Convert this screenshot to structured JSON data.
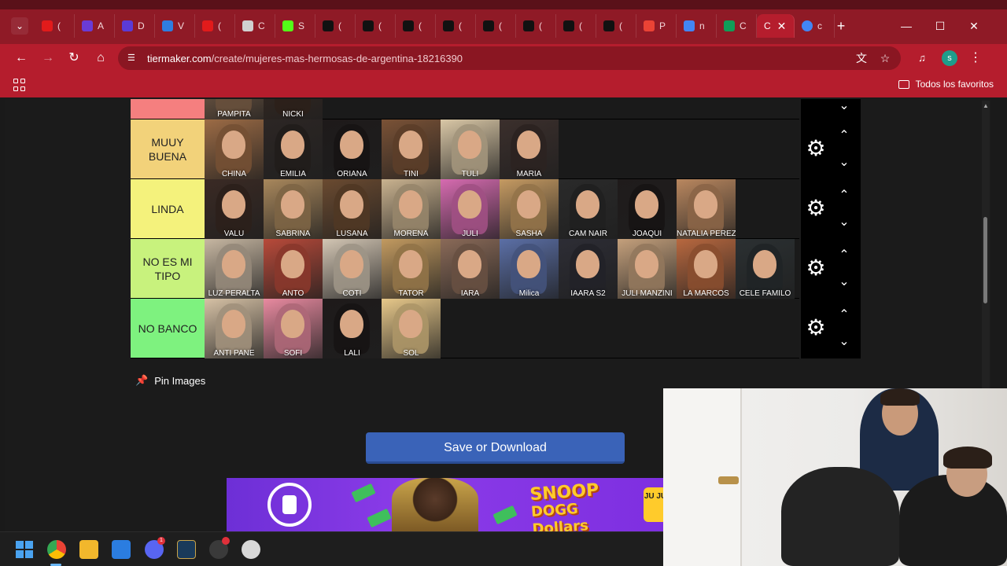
{
  "browser": {
    "tabs": [
      {
        "icon": "youtube-icon",
        "label": "(",
        "color": "#e21b1b"
      },
      {
        "icon": "moon-icon",
        "label": "A",
        "color": "#6a3bd6"
      },
      {
        "icon": "moon-icon",
        "label": "D",
        "color": "#5b3bd6"
      },
      {
        "icon": "check-icon",
        "label": "V",
        "color": "#2e7de0"
      },
      {
        "icon": "youtube-icon",
        "label": "(",
        "color": "#e21b1b"
      },
      {
        "icon": "openai-icon",
        "label": "C",
        "color": "#d0d0d0"
      },
      {
        "icon": "kick-icon",
        "label": "S",
        "color": "#53fc18"
      },
      {
        "icon": "tiktok-icon",
        "label": "(",
        "color": "#111111"
      },
      {
        "icon": "tiktok-icon",
        "label": "(",
        "color": "#111111"
      },
      {
        "icon": "tiktok-icon",
        "label": "(",
        "color": "#111111"
      },
      {
        "icon": "tiktok-icon",
        "label": "(",
        "color": "#111111"
      },
      {
        "icon": "tiktok-icon",
        "label": "(",
        "color": "#111111"
      },
      {
        "icon": "tiktok-icon",
        "label": "(",
        "color": "#111111"
      },
      {
        "icon": "tiktok-icon",
        "label": "(",
        "color": "#111111"
      },
      {
        "icon": "tiktok-icon",
        "label": "(",
        "color": "#111111"
      },
      {
        "icon": "gmail-icon",
        "label": "P",
        "color": "#ea4335"
      },
      {
        "icon": "google-icon",
        "label": "n",
        "color": "#4285f4"
      },
      {
        "icon": "sheets-icon",
        "label": "C",
        "color": "#0f9d58"
      }
    ],
    "active_tab_label": "C",
    "last_tab": {
      "icon": "google-icon",
      "label": "c"
    },
    "url_host": "tiermaker.com",
    "url_path": "/create/mujeres-mas-hermosas-de-argentina-18216390",
    "all_bookmarks_label": "Todos los favoritos",
    "profile_initial": "s"
  },
  "tier_list": {
    "top_partial_row": {
      "color": "#f57f7f",
      "items": [
        {
          "caption": "PAMPITA",
          "tone": "#8a6a50"
        },
        {
          "caption": "NICKI",
          "tone": "#3a2a22"
        }
      ]
    },
    "rows": [
      {
        "label": "MUUY BUENA",
        "color": "#f2d27a",
        "items": [
          {
            "caption": "CHINA",
            "tone": "#9c6b45"
          },
          {
            "caption": "EMILIA",
            "tone": "#2c2624"
          },
          {
            "caption": "ORIANA",
            "tone": "#1e1a1a"
          },
          {
            "caption": "TINI",
            "tone": "#7a5236"
          },
          {
            "caption": "TULI",
            "tone": "#d9c7a6"
          },
          {
            "caption": "MARIA",
            "tone": "#3b2f2c"
          }
        ]
      },
      {
        "label": "LINDA",
        "color": "#f4f27c",
        "items": [
          {
            "caption": "VALU",
            "tone": "#3a2a24"
          },
          {
            "caption": "SABRINA",
            "tone": "#a8875c"
          },
          {
            "caption": "LUSANA",
            "tone": "#6a4a30"
          },
          {
            "caption": "MORENA",
            "tone": "#c9b28f"
          },
          {
            "caption": "JULI",
            "tone": "#d66bb0"
          },
          {
            "caption": "SASHA",
            "tone": "#c59a62"
          },
          {
            "caption": "CAM NAIR",
            "tone": "#2a2a2a"
          },
          {
            "caption": "JOAQUI",
            "tone": "#1f1b1b"
          },
          {
            "caption": "NATALIA PEREZ",
            "tone": "#b9875f"
          }
        ]
      },
      {
        "label": "NO ES MI TIPO",
        "color": "#c8f27d",
        "items": [
          {
            "caption": "LUZ PERALTA",
            "tone": "#c7b7a2"
          },
          {
            "caption": "ANTO",
            "tone": "#b84a3a"
          },
          {
            "caption": "COTI",
            "tone": "#d3c6b4"
          },
          {
            "caption": "TATOR",
            "tone": "#c29a60"
          },
          {
            "caption": "IARA",
            "tone": "#8a6a58"
          },
          {
            "caption": "Milica",
            "tone": "#5b6fa6"
          },
          {
            "caption": "IAARA S2",
            "tone": "#2d2d35"
          },
          {
            "caption": "JULI MANZINI",
            "tone": "#c4a07c"
          },
          {
            "caption": "LA MARCOS",
            "tone": "#b8683f"
          },
          {
            "caption": "CELE FAMILO",
            "tone": "#2b3032"
          }
        ]
      },
      {
        "label": "NO BANCO",
        "color": "#7ef27f",
        "items": [
          {
            "caption": "ANTI PANE",
            "tone": "#d6c1a5"
          },
          {
            "caption": "SOFI",
            "tone": "#e88aa0"
          },
          {
            "caption": "LALI",
            "tone": "#1e1a1a"
          },
          {
            "caption": "SOL",
            "tone": "#e7c88a"
          }
        ]
      }
    ]
  },
  "pin_images_label": "Pin Images",
  "save_button_label": "Save or Download",
  "ad": {
    "title_line1": "SNOOP",
    "title_line2": "DOGG",
    "title_line3": "Dollars",
    "cta": "JU JU"
  },
  "taskbar": {
    "discord_badge": "1"
  }
}
